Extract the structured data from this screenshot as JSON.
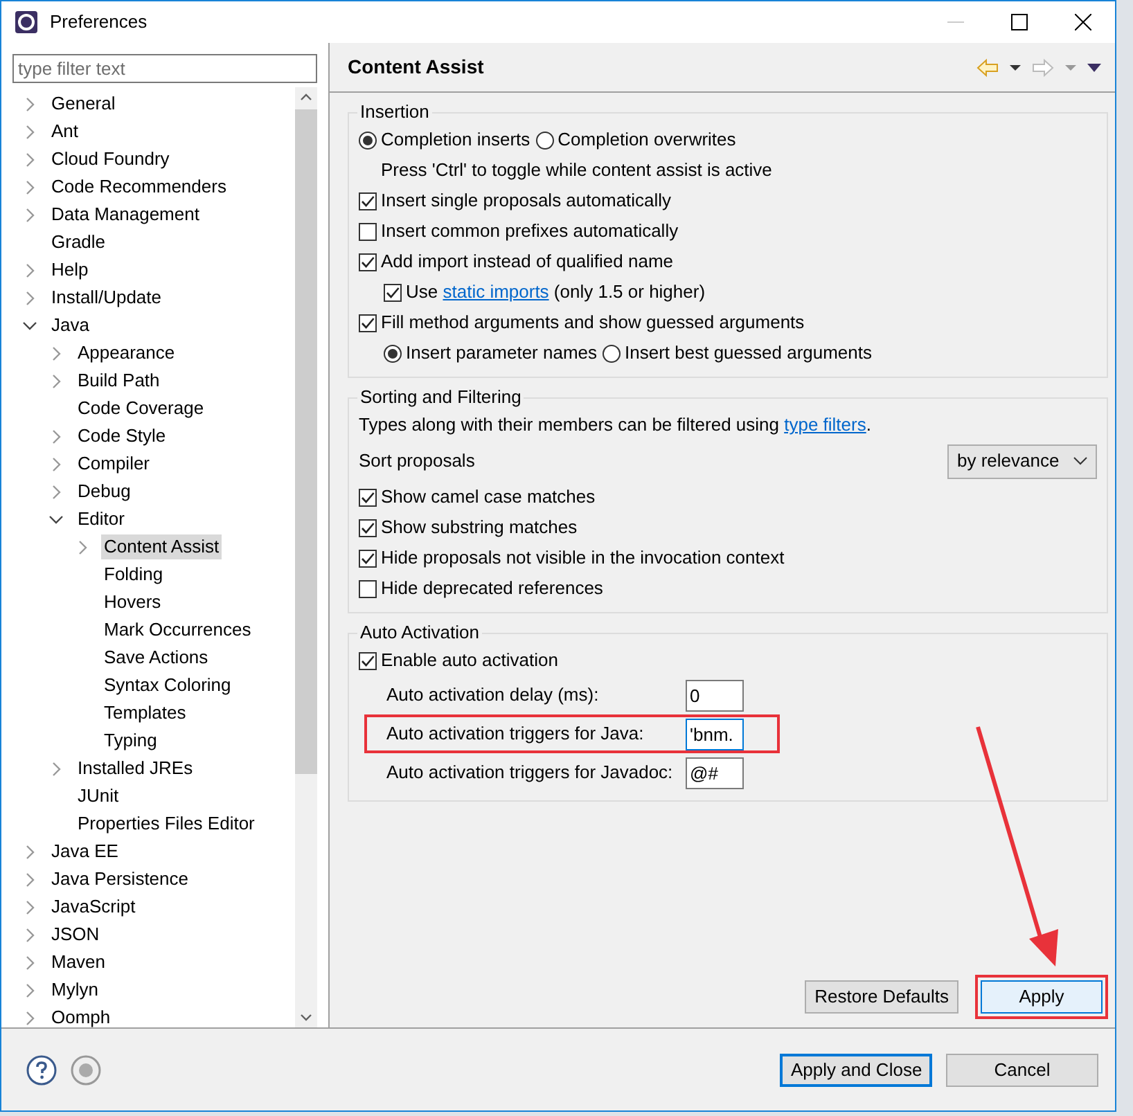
{
  "window": {
    "title": "Preferences"
  },
  "filter": {
    "placeholder": "type filter text"
  },
  "tree": [
    {
      "label": "General",
      "kind": "folder",
      "expanded": false,
      "selected": false
    },
    {
      "label": "Ant",
      "kind": "folder",
      "expanded": false,
      "selected": false
    },
    {
      "label": "Cloud Foundry",
      "kind": "folder",
      "expanded": false,
      "selected": false
    },
    {
      "label": "Code Recommenders",
      "kind": "folder",
      "expanded": false,
      "selected": false
    },
    {
      "label": "Data Management",
      "kind": "folder",
      "expanded": false,
      "selected": false
    },
    {
      "label": "Gradle",
      "kind": "leaf",
      "selected": false
    },
    {
      "label": "Help",
      "kind": "folder",
      "expanded": false,
      "selected": false
    },
    {
      "label": "Install/Update",
      "kind": "folder",
      "expanded": false,
      "selected": false
    },
    {
      "label": "Java",
      "kind": "folder",
      "expanded": true,
      "selected": false,
      "children": [
        {
          "label": "Appearance",
          "kind": "folder",
          "expanded": false,
          "selected": false
        },
        {
          "label": "Build Path",
          "kind": "folder",
          "expanded": false,
          "selected": false
        },
        {
          "label": "Code Coverage",
          "kind": "leaf",
          "selected": false
        },
        {
          "label": "Code Style",
          "kind": "folder",
          "expanded": false,
          "selected": false
        },
        {
          "label": "Compiler",
          "kind": "folder",
          "expanded": false,
          "selected": false
        },
        {
          "label": "Debug",
          "kind": "folder",
          "expanded": false,
          "selected": false
        },
        {
          "label": "Editor",
          "kind": "folder",
          "expanded": true,
          "selected": false,
          "children": [
            {
              "label": "Content Assist",
              "kind": "folder",
              "expanded": false,
              "selected": true
            },
            {
              "label": "Folding",
              "kind": "leaf",
              "selected": false
            },
            {
              "label": "Hovers",
              "kind": "leaf",
              "selected": false
            },
            {
              "label": "Mark Occurrences",
              "kind": "leaf",
              "selected": false
            },
            {
              "label": "Save Actions",
              "kind": "leaf",
              "selected": false
            },
            {
              "label": "Syntax Coloring",
              "kind": "leaf",
              "selected": false
            },
            {
              "label": "Templates",
              "kind": "leaf",
              "selected": false
            },
            {
              "label": "Typing",
              "kind": "leaf",
              "selected": false
            }
          ]
        },
        {
          "label": "Installed JREs",
          "kind": "folder",
          "expanded": false,
          "selected": false
        },
        {
          "label": "JUnit",
          "kind": "leaf",
          "selected": false
        },
        {
          "label": "Properties Files Editor",
          "kind": "leaf",
          "selected": false
        }
      ]
    },
    {
      "label": "Java EE",
      "kind": "folder",
      "expanded": false,
      "selected": false
    },
    {
      "label": "Java Persistence",
      "kind": "folder",
      "expanded": false,
      "selected": false
    },
    {
      "label": "JavaScript",
      "kind": "folder",
      "expanded": false,
      "selected": false
    },
    {
      "label": "JSON",
      "kind": "folder",
      "expanded": false,
      "selected": false
    },
    {
      "label": "Maven",
      "kind": "folder",
      "expanded": false,
      "selected": false
    },
    {
      "label": "Mylyn",
      "kind": "folder",
      "expanded": false,
      "selected": false
    },
    {
      "label": "Oomph",
      "kind": "folder",
      "expanded": false,
      "selected": false
    }
  ],
  "page": {
    "title": "Content Assist",
    "groups": [
      {
        "title": "Insertion",
        "items": [
          {
            "kind": "radio-row",
            "options": [
              {
                "label": "Completion inserts",
                "selected": true
              },
              {
                "label": "Completion overwrites",
                "selected": false
              }
            ]
          },
          {
            "kind": "note",
            "text": "Press 'Ctrl' to toggle while content assist is active"
          },
          {
            "kind": "checkbox",
            "label": "Insert single proposals automatically",
            "checked": true
          },
          {
            "kind": "checkbox",
            "label": "Insert common prefixes automatically",
            "checked": false
          },
          {
            "kind": "checkbox",
            "label": "Add import instead of qualified name",
            "checked": true,
            "children": [
              {
                "kind": "checkbox",
                "label": "Use ",
                "link": "static imports",
                "after": " (only 1.5 or higher)",
                "checked": true
              }
            ]
          },
          {
            "kind": "checkbox",
            "label": "Fill method arguments and show guessed arguments",
            "checked": true,
            "children": [
              {
                "kind": "radio-row",
                "options": [
                  {
                    "label": "Insert parameter names",
                    "selected": true
                  },
                  {
                    "label": "Insert best guessed arguments",
                    "selected": false
                  }
                ]
              }
            ]
          }
        ]
      },
      {
        "title": "Sorting and Filtering",
        "items": [
          {
            "kind": "text",
            "label": "Types along with their members can be filtered using ",
            "link": "type filters",
            "after": "."
          },
          {
            "kind": "select",
            "label": "Sort proposals",
            "value": "by relevance"
          },
          {
            "kind": "checkbox",
            "label": "Show camel case matches",
            "checked": true
          },
          {
            "kind": "checkbox",
            "label": "Show substring matches",
            "checked": true
          },
          {
            "kind": "checkbox",
            "label": "Hide proposals not visible in the invocation context",
            "checked": true
          },
          {
            "kind": "checkbox",
            "label": "Hide deprecated references",
            "checked": false
          }
        ]
      },
      {
        "title": "Auto Activation",
        "items": [
          {
            "kind": "checkbox",
            "label": "Enable auto activation",
            "checked": true,
            "children": [
              {
                "kind": "field",
                "label": "Auto activation delay (ms):",
                "value": "0",
                "highlighted": false
              },
              {
                "kind": "field",
                "label": "Auto activation triggers for Java:",
                "value": "'bnm.",
                "highlighted": true
              },
              {
                "kind": "field",
                "label": "Auto activation triggers for Javadoc:",
                "value": "@#",
                "highlighted": false
              }
            ]
          }
        ]
      }
    ],
    "buttons": [
      {
        "label": "Restore Defaults",
        "highlighted": false
      },
      {
        "label": "Apply",
        "highlighted": true
      }
    ]
  },
  "footer_buttons": [
    {
      "label": "Apply and Close",
      "default": true
    },
    {
      "label": "Cancel",
      "default": false
    }
  ],
  "annotation_arrow": true
}
